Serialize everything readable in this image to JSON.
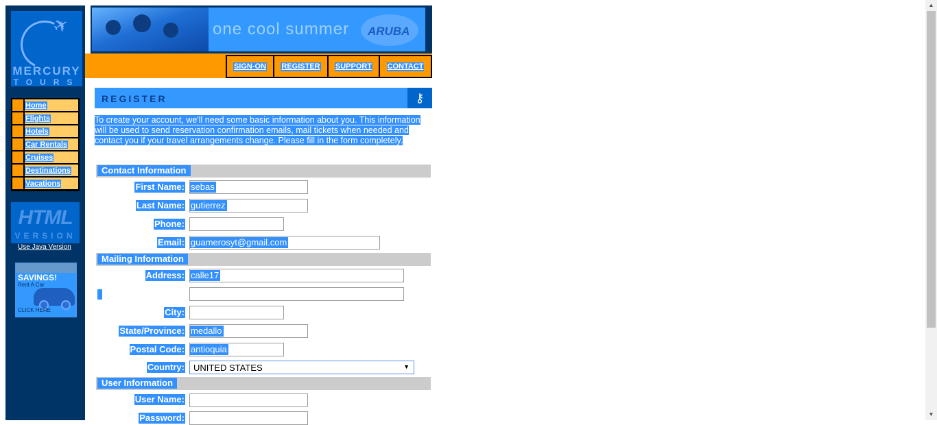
{
  "logo": {
    "line1": "MERCURY",
    "line2": "TOURS"
  },
  "sidebar": {
    "items": [
      {
        "label": "Home"
      },
      {
        "label": "Flights"
      },
      {
        "label": "Hotels"
      },
      {
        "label": "Car Rentals"
      },
      {
        "label": "Cruises"
      },
      {
        "label": "Destinations"
      },
      {
        "label": "Vacations"
      }
    ],
    "html_version": {
      "big": "HTML",
      "small": "VERSION"
    },
    "java_link": "Use Java Version",
    "ad": {
      "title": "SAVINGS!",
      "subtitle": "Rent A Car",
      "cta": "CLICK HERE"
    }
  },
  "banner": {
    "slogan": "one cool summer",
    "brand": "ARUBA"
  },
  "topnav": [
    "SIGN-ON",
    "REGISTER",
    "SUPPORT",
    "CONTACT"
  ],
  "page_header": "REGISTER",
  "intro": "To create your account, we'll need some basic information about you. This information will be used to send reservation confirmation emails, mail tickets when needed and contact you if your travel arrangements change. Please fill in the form completely.",
  "sections": {
    "contact": "Contact Information",
    "mailing": "Mailing Information",
    "user": "User Information"
  },
  "fields": {
    "first_name": {
      "label": "First Name:",
      "value": "sebas"
    },
    "last_name": {
      "label": "Last Name:",
      "value": "gutierrez"
    },
    "phone": {
      "label": "Phone:",
      "value": ""
    },
    "email": {
      "label": "Email:",
      "value": "guamerosyt@gmail.com"
    },
    "address": {
      "label": "Address:",
      "value": "calle17"
    },
    "address2": {
      "value": ""
    },
    "city": {
      "label": "City:",
      "value": ""
    },
    "state": {
      "label": "State/Province:",
      "value": "medallo"
    },
    "postal": {
      "label": "Postal Code:",
      "value": "antioquia"
    },
    "country": {
      "label": "Country:",
      "value": "UNITED STATES"
    },
    "username": {
      "label": "User Name:",
      "value": ""
    },
    "password": {
      "label": "Password:",
      "value": ""
    }
  },
  "colors": {
    "sidebar_bg": "#003366",
    "accent_orange": "#ff9900",
    "nav_cell": "#ffcc66",
    "selection": "#3390ff",
    "header_blue": "#3399ff"
  }
}
